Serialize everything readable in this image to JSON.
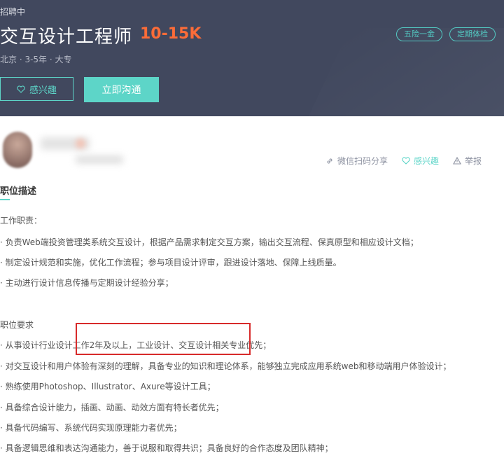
{
  "header": {
    "status": "招聘中",
    "title": "交互设计工程师",
    "salary": "10-15K",
    "meta": "北京 · 3-5年 · 大专",
    "tags": [
      "五险一金",
      "定期体检"
    ],
    "interest_label": "感兴趣",
    "chat_label": "立即沟通"
  },
  "actions": {
    "share_label": "微信扫码分享",
    "interest_label": "感兴趣",
    "report_label": "举报"
  },
  "section": {
    "title": "职位描述"
  },
  "description": {
    "duties_heading": "工作职责：",
    "duties": [
      "· 负责Web端投资管理类系统交互设计，根据产品需求制定交互方案，输出交互流程、保真原型和相应设计文档；",
      "· 制定设计规范和实施，优化工作流程；参与项目设计评审，跟进设计落地、保障上线质量。",
      "· 主动进行设计信息传播与定期设计经验分享；"
    ],
    "requirements_heading": "职位要求",
    "requirements": [
      "· 从事设计行业设计工作2年及以上，工业设计、交互设计相关专业优先；",
      "· 对交互设计和用户体验有深刻的理解，具备专业的知识和理论体系，能够独立完成应用系统web和移动端用户体验设计；",
      "· 熟练使用Photoshop、Illustrator、Axure等设计工具；",
      "· 具备综合设计能力，插画、动画、动效方面有特长者优先；",
      "· 具备代码编写、系统代码实现原理能力者优先；",
      "· 具备逻辑思维和表达沟通能力，善于说服和取得共识；具备良好的合作态度及团队精神；"
    ]
  },
  "colors": {
    "header_bg": "#41485e",
    "accent": "#5dd5c8",
    "salary": "#fc6c38",
    "highlight": "#d72a2a"
  }
}
